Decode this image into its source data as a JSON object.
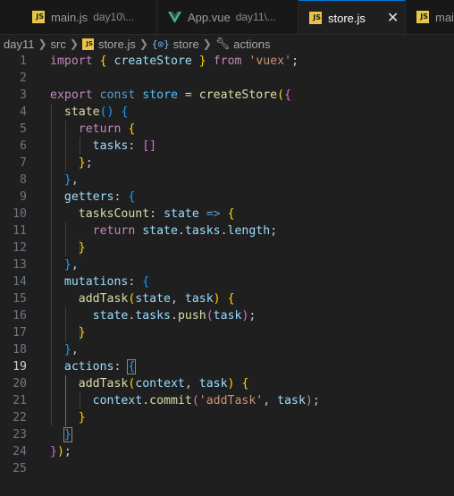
{
  "tabs": [
    {
      "label": "main.js",
      "description": "day10\\...",
      "icon": "js-file-icon"
    },
    {
      "label": "App.vue",
      "description": "day11\\...",
      "icon": "vue-file-icon"
    },
    {
      "label": "store.js",
      "description": "",
      "icon": "js-file-icon",
      "active": true,
      "close": "✕"
    },
    {
      "label": "mai",
      "description": "",
      "icon": "js-file-icon"
    }
  ],
  "breadcrumb": {
    "folder1": "day11",
    "folder2": "src",
    "file": "store.js",
    "symbol": "store",
    "member": "actions",
    "symbol_icon": "{⊙}",
    "member_icon": "wrench-icon"
  },
  "editor": {
    "current_line": 19,
    "line_numbers": [
      "1",
      "2",
      "3",
      "4",
      "5",
      "6",
      "7",
      "8",
      "9",
      "10",
      "11",
      "12",
      "13",
      "14",
      "15",
      "16",
      "17",
      "18",
      "19",
      "20",
      "21",
      "22",
      "23",
      "24",
      "25"
    ],
    "lines": [
      [
        [
          "kw",
          "import"
        ],
        [
          "pun",
          " "
        ],
        [
          "b1",
          "{"
        ],
        [
          "pun",
          " "
        ],
        [
          "var",
          "createStore"
        ],
        [
          "pun",
          " "
        ],
        [
          "b1",
          "}"
        ],
        [
          "pun",
          " "
        ],
        [
          "kw",
          "from"
        ],
        [
          "pun",
          " "
        ],
        [
          "str",
          "'vuex'"
        ],
        [
          "pun",
          ";"
        ]
      ],
      [],
      [
        [
          "kw",
          "export"
        ],
        [
          "pun",
          " "
        ],
        [
          "kw2",
          "const"
        ],
        [
          "pun",
          " "
        ],
        [
          "const",
          "store"
        ],
        [
          "pun",
          " = "
        ],
        [
          "fn",
          "createStore"
        ],
        [
          "b1",
          "("
        ],
        [
          "b2",
          "{"
        ]
      ],
      [
        [
          "pun",
          "  "
        ],
        [
          "fn",
          "state"
        ],
        [
          "b3",
          "()"
        ],
        [
          "pun",
          " "
        ],
        [
          "b3",
          "{"
        ]
      ],
      [
        [
          "pun",
          "    "
        ],
        [
          "kw",
          "return"
        ],
        [
          "pun",
          " "
        ],
        [
          "b1",
          "{"
        ]
      ],
      [
        [
          "pun",
          "      "
        ],
        [
          "var",
          "tasks"
        ],
        [
          "pun",
          ": "
        ],
        [
          "b2",
          "[]"
        ]
      ],
      [
        [
          "pun",
          "    "
        ],
        [
          "b1",
          "}"
        ],
        [
          "pun",
          ";"
        ]
      ],
      [
        [
          "pun",
          "  "
        ],
        [
          "b3",
          "}"
        ],
        [
          "pun",
          ","
        ]
      ],
      [
        [
          "pun",
          "  "
        ],
        [
          "var",
          "getters"
        ],
        [
          "pun",
          ": "
        ],
        [
          "b3",
          "{"
        ]
      ],
      [
        [
          "pun",
          "    "
        ],
        [
          "fn",
          "tasksCount"
        ],
        [
          "pun",
          ": "
        ],
        [
          "var",
          "state"
        ],
        [
          "pun",
          " "
        ],
        [
          "kw2",
          "=>"
        ],
        [
          "pun",
          " "
        ],
        [
          "b1",
          "{"
        ]
      ],
      [
        [
          "pun",
          "      "
        ],
        [
          "kw",
          "return"
        ],
        [
          "pun",
          " "
        ],
        [
          "var",
          "state"
        ],
        [
          "pun",
          "."
        ],
        [
          "var",
          "tasks"
        ],
        [
          "pun",
          "."
        ],
        [
          "var",
          "length"
        ],
        [
          "pun",
          ";"
        ]
      ],
      [
        [
          "pun",
          "    "
        ],
        [
          "b1",
          "}"
        ]
      ],
      [
        [
          "pun",
          "  "
        ],
        [
          "b3",
          "}"
        ],
        [
          "pun",
          ","
        ]
      ],
      [
        [
          "pun",
          "  "
        ],
        [
          "var",
          "mutations"
        ],
        [
          "pun",
          ": "
        ],
        [
          "b3",
          "{"
        ]
      ],
      [
        [
          "pun",
          "    "
        ],
        [
          "fn",
          "addTask"
        ],
        [
          "b1",
          "("
        ],
        [
          "var",
          "state"
        ],
        [
          "pun",
          ", "
        ],
        [
          "var",
          "task"
        ],
        [
          "b1",
          ")"
        ],
        [
          "pun",
          " "
        ],
        [
          "b1",
          "{"
        ]
      ],
      [
        [
          "pun",
          "      "
        ],
        [
          "var",
          "state"
        ],
        [
          "pun",
          "."
        ],
        [
          "var",
          "tasks"
        ],
        [
          "pun",
          "."
        ],
        [
          "fn",
          "push"
        ],
        [
          "b2",
          "("
        ],
        [
          "var",
          "task"
        ],
        [
          "b2",
          ")"
        ],
        [
          "pun",
          ";"
        ]
      ],
      [
        [
          "pun",
          "    "
        ],
        [
          "b1",
          "}"
        ]
      ],
      [
        [
          "pun",
          "  "
        ],
        [
          "b3",
          "}"
        ],
        [
          "pun",
          ","
        ]
      ],
      [
        [
          "pun",
          "  "
        ],
        [
          "var",
          "actions"
        ],
        [
          "pun",
          ": "
        ],
        [
          "b3 boxed",
          "{"
        ]
      ],
      [
        [
          "pun",
          "    "
        ],
        [
          "fn",
          "addTask"
        ],
        [
          "b1",
          "("
        ],
        [
          "var",
          "context"
        ],
        [
          "pun",
          ", "
        ],
        [
          "var",
          "task"
        ],
        [
          "b1",
          ")"
        ],
        [
          "pun",
          " "
        ],
        [
          "b1",
          "{"
        ]
      ],
      [
        [
          "pun",
          "      "
        ],
        [
          "var",
          "context"
        ],
        [
          "pun",
          "."
        ],
        [
          "fn",
          "commit"
        ],
        [
          "b2",
          "("
        ],
        [
          "str",
          "'addTask'"
        ],
        [
          "pun",
          ", "
        ],
        [
          "var",
          "task"
        ],
        [
          "b2",
          ")"
        ],
        [
          "pun",
          ";"
        ]
      ],
      [
        [
          "pun",
          "    "
        ],
        [
          "b1",
          "}"
        ]
      ],
      [
        [
          "pun",
          "  "
        ],
        [
          "b3 boxed",
          "}"
        ]
      ],
      [
        [
          "b2",
          "}"
        ],
        [
          "b1",
          ")"
        ],
        [
          "pun",
          ";"
        ]
      ],
      []
    ]
  }
}
